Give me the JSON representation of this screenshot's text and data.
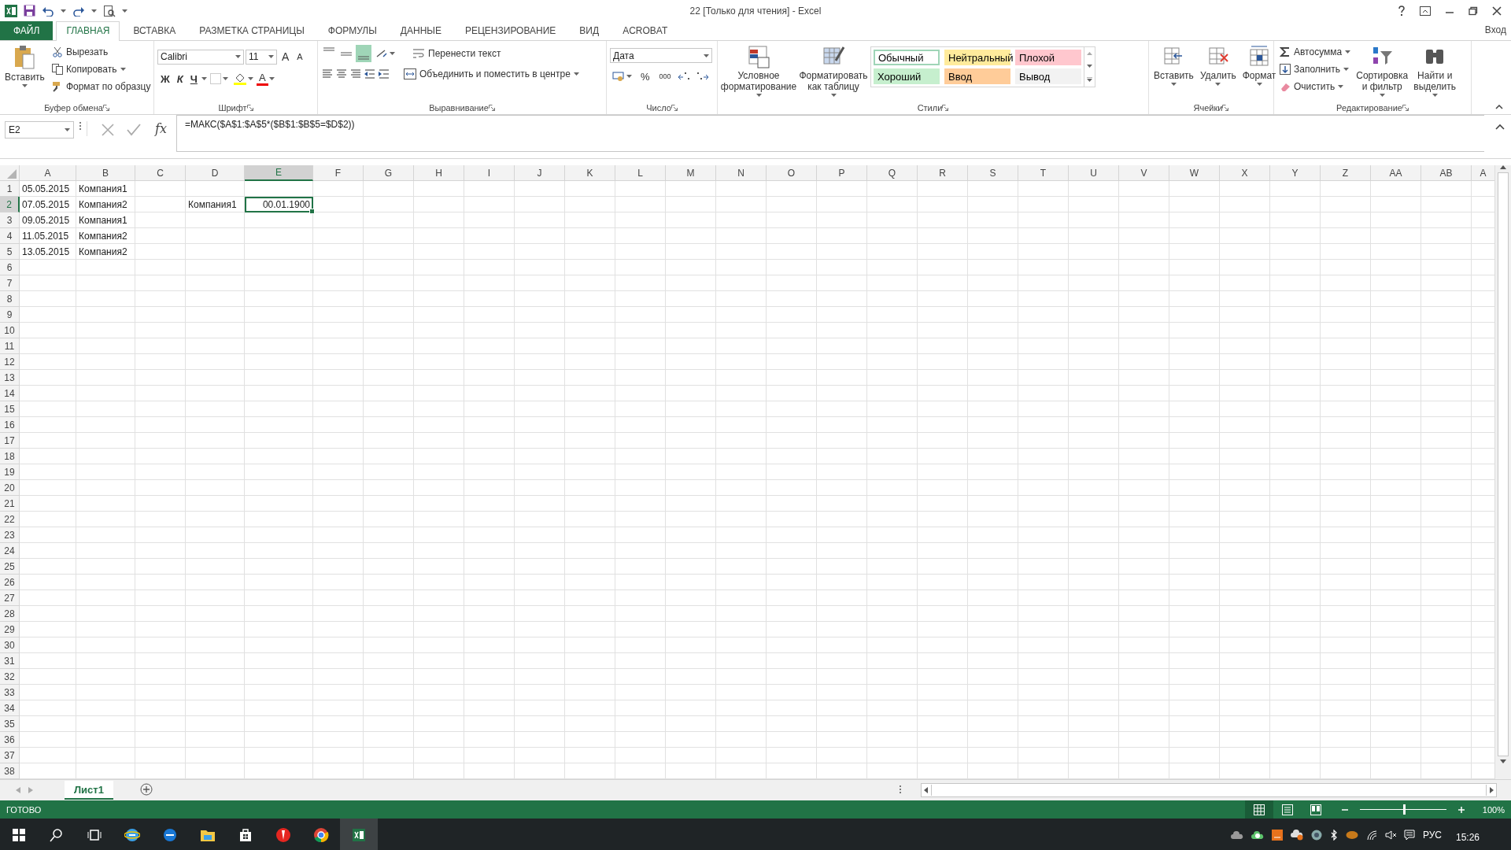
{
  "window": {
    "title": "22  [Только для чтения] - Excel",
    "account": "Вход"
  },
  "tabs": [
    {
      "label": "ФАЙЛ",
      "kind": "file",
      "selected": false
    },
    {
      "label": "ГЛАВНАЯ",
      "kind": "tab",
      "selected": true
    },
    {
      "label": "ВСТАВКА",
      "kind": "tab",
      "selected": false
    },
    {
      "label": "РАЗМЕТКА СТРАНИЦЫ",
      "kind": "tab",
      "selected": false
    },
    {
      "label": "ФОРМУЛЫ",
      "kind": "tab",
      "selected": false
    },
    {
      "label": "ДАННЫЕ",
      "kind": "tab",
      "selected": false
    },
    {
      "label": "РЕЦЕНЗИРОВАНИЕ",
      "kind": "tab",
      "selected": false
    },
    {
      "label": "ВИД",
      "kind": "tab",
      "selected": false
    },
    {
      "label": "ACROBAT",
      "kind": "tab",
      "selected": false
    }
  ],
  "clipboard": {
    "paste": "Вставить",
    "cut": "Вырезать",
    "copy": "Копировать",
    "format_painter": "Формат по образцу",
    "label": "Буфер обмена"
  },
  "font": {
    "name": "Calibri",
    "size": "11",
    "grow": "A",
    "shrink": "A",
    "bold": "Ж",
    "italic": "К",
    "underline": "Ч",
    "font_color_button": "A",
    "label": "Шрифт"
  },
  "alignment": {
    "vertical": [
      {
        "selected": false
      },
      {
        "selected": false
      },
      {
        "selected": true
      }
    ],
    "wrap": "Перенести текст",
    "merge": "Объединить и поместить в центре",
    "label": "Выравнивание"
  },
  "number": {
    "format": "Дата",
    "percent": "%",
    "thousands": "000",
    "label": "Число"
  },
  "styles": {
    "conditional": "Условное форматирование",
    "as_table": "Форматировать как таблицу",
    "label": "Стили",
    "cell_styles": [
      {
        "label": "Обычный",
        "color": "#ffffff",
        "selected": true
      },
      {
        "label": "Нейтральный",
        "color": "#ffeb9c",
        "selected": false
      },
      {
        "label": "Плохой",
        "color": "#ffc7ce",
        "selected": false
      },
      {
        "label": "Хороший",
        "color": "#c6efce",
        "selected": false
      },
      {
        "label": "Ввод",
        "color": "#ffcc99",
        "selected": false
      },
      {
        "label": "Вывод",
        "color": "#f2f2f2",
        "selected": false
      }
    ]
  },
  "cells_group": {
    "insert": "Вставить",
    "delete": "Удалить",
    "format": "Формат",
    "label": "Ячейки"
  },
  "editing": {
    "autosum": "Автосумма",
    "fill": "Заполнить",
    "clear": "Очистить",
    "sort": "Сортировка и фильтр",
    "find": "Найти и выделить",
    "label": "Редактирование"
  },
  "formula_bar": {
    "name_box": "E2",
    "function_button": "fx",
    "formula": "=МАКС($A$1:$A$5*($B$1:$B$5=$D$2))"
  },
  "sheet": {
    "columns": [
      {
        "label": "A",
        "selected": false
      },
      {
        "label": "B",
        "selected": false
      },
      {
        "label": "C",
        "selected": false
      },
      {
        "label": "D",
        "selected": false
      },
      {
        "label": "E",
        "selected": true
      },
      {
        "label": "F",
        "selected": false
      },
      {
        "label": "G",
        "selected": false
      },
      {
        "label": "H",
        "selected": false
      },
      {
        "label": "I",
        "selected": false
      },
      {
        "label": "J",
        "selected": false
      },
      {
        "label": "K",
        "selected": false
      },
      {
        "label": "L",
        "selected": false
      },
      {
        "label": "M",
        "selected": false
      },
      {
        "label": "N",
        "selected": false
      },
      {
        "label": "O",
        "selected": false
      },
      {
        "label": "P",
        "selected": false
      },
      {
        "label": "Q",
        "selected": false
      },
      {
        "label": "R",
        "selected": false
      },
      {
        "label": "S",
        "selected": false
      },
      {
        "label": "T",
        "selected": false
      },
      {
        "label": "U",
        "selected": false
      },
      {
        "label": "V",
        "selected": false
      },
      {
        "label": "W",
        "selected": false
      },
      {
        "label": "X",
        "selected": false
      },
      {
        "label": "Y",
        "selected": false
      },
      {
        "label": "Z",
        "selected": false
      },
      {
        "label": "AA",
        "selected": false
      },
      {
        "label": "AB",
        "selected": false
      },
      {
        "label": "A",
        "selected": false
      }
    ],
    "rows": [
      {
        "number": "1",
        "selected": false,
        "column_1": {
          "value": "05.05.2015",
          "kind": "text",
          "selected": false
        },
        "column_2": {
          "value": "Компания1",
          "kind": "text",
          "selected": false
        }
      },
      {
        "number": "2",
        "selected": true,
        "column_1": {
          "value": "07.05.2015",
          "kind": "text",
          "selected": false
        },
        "column_2": {
          "value": "Компания2",
          "kind": "text",
          "selected": false
        },
        "column_4": {
          "value": "Компания1",
          "kind": "text",
          "selected": false
        },
        "column_5": {
          "value": "00.01.1900",
          "kind": "number",
          "selected": true
        }
      },
      {
        "number": "3",
        "selected": false,
        "column_1": {
          "value": "09.05.2015",
          "kind": "text",
          "selected": false
        },
        "column_2": {
          "value": "Компания1",
          "kind": "text",
          "selected": false
        }
      },
      {
        "number": "4",
        "selected": false,
        "column_1": {
          "value": "11.05.2015",
          "kind": "text",
          "selected": false
        },
        "column_2": {
          "value": "Компания2",
          "kind": "text",
          "selected": false
        }
      },
      {
        "number": "5",
        "selected": false,
        "column_1": {
          "value": "13.05.2015",
          "kind": "text",
          "selected": false
        },
        "column_2": {
          "value": "Компания2",
          "kind": "text",
          "selected": false
        }
      },
      {
        "number": "6",
        "selected": false
      },
      {
        "number": "7",
        "selected": false
      },
      {
        "number": "8",
        "selected": false
      },
      {
        "number": "9",
        "selected": false
      },
      {
        "number": "10",
        "selected": false
      },
      {
        "number": "11",
        "selected": false
      },
      {
        "number": "12",
        "selected": false
      },
      {
        "number": "13",
        "selected": false
      },
      {
        "number": "14",
        "selected": false
      },
      {
        "number": "15",
        "selected": false
      },
      {
        "number": "16",
        "selected": false
      },
      {
        "number": "17",
        "selected": false
      },
      {
        "number": "18",
        "selected": false
      },
      {
        "number": "19",
        "selected": false
      },
      {
        "number": "20",
        "selected": false
      },
      {
        "number": "21",
        "selected": false
      },
      {
        "number": "22",
        "selected": false
      },
      {
        "number": "23",
        "selected": false
      },
      {
        "number": "24",
        "selected": false
      },
      {
        "number": "25",
        "selected": false
      },
      {
        "number": "26",
        "selected": false
      },
      {
        "number": "27",
        "selected": false
      },
      {
        "number": "28",
        "selected": false
      },
      {
        "number": "29",
        "selected": false
      },
      {
        "number": "30",
        "selected": false
      },
      {
        "number": "31",
        "selected": false
      },
      {
        "number": "32",
        "selected": false
      },
      {
        "number": "33",
        "selected": false
      },
      {
        "number": "34",
        "selected": false
      },
      {
        "number": "35",
        "selected": false
      },
      {
        "number": "36",
        "selected": false
      },
      {
        "number": "37",
        "selected": false
      },
      {
        "number": "38",
        "selected": false
      }
    ]
  },
  "sheet_tabs": [
    {
      "label": "Лист1",
      "selected": true
    }
  ],
  "status_bar": {
    "status": "ГОТОВО",
    "level": 0.5,
    "zoom": "100%"
  },
  "taskbar": {
    "language": "РУС",
    "time": "15:26"
  }
}
